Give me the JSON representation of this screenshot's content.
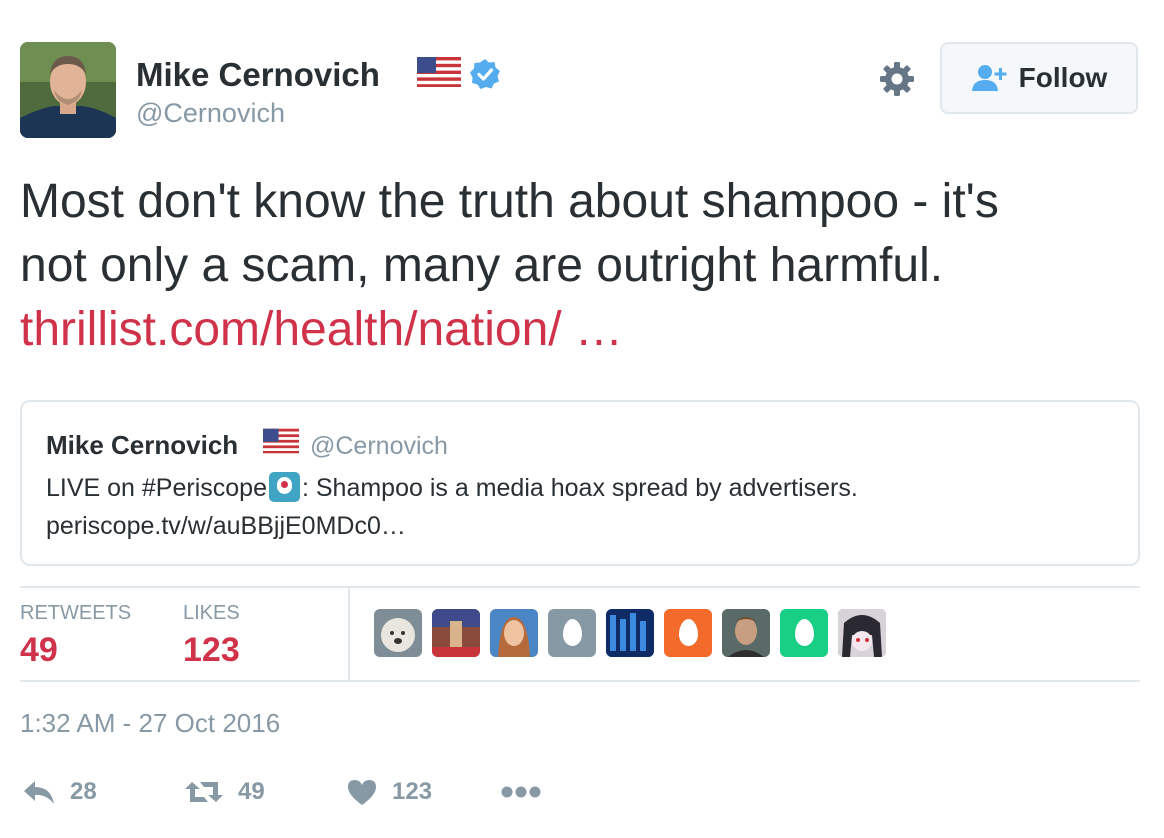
{
  "user": {
    "display_name": "Mike Cernovich",
    "handle": "@Cernovich",
    "flag_icon": "us-flag-icon",
    "verified_icon": "verified-badge-icon"
  },
  "header": {
    "follow_label": "Follow",
    "settings_icon": "gear-icon"
  },
  "tweet": {
    "line1": "Most don't know the truth about shampoo - it's",
    "line2": "not only a scam, many are outright harmful.",
    "link": "thrillist.com/health/nation/ …"
  },
  "quote": {
    "name": "Mike Cernovich",
    "handle": "@Cernovich",
    "text_prefix": "LIVE on #Periscope",
    "text_suffix": ": Shampoo is a media hoax spread by advertisers.",
    "link": "periscope.tv/w/auBBjjE0MDc0…"
  },
  "stats": {
    "retweets_label": "RETWEETS",
    "retweets_value": "49",
    "likes_label": "LIKES",
    "likes_value": "123"
  },
  "likers": [
    {
      "kind": "photo",
      "color": "#7f8d96"
    },
    {
      "kind": "photo",
      "color": "#8a4a3c"
    },
    {
      "kind": "photo",
      "color": "#b98467"
    },
    {
      "kind": "egg",
      "color": "#8899a6"
    },
    {
      "kind": "photo",
      "color": "#1f4f9e"
    },
    {
      "kind": "egg",
      "color": "#f26b2a"
    },
    {
      "kind": "photo",
      "color": "#6e7a7a"
    },
    {
      "kind": "egg",
      "color": "#19cf86"
    },
    {
      "kind": "photo",
      "color": "#3c3a40"
    }
  ],
  "timestamp": "1:32 AM - 27 Oct 2016",
  "actions": {
    "reply_count": "28",
    "retweet_count": "49",
    "like_count": "123"
  },
  "colors": {
    "accent": "#d0324a",
    "muted": "#8899a6",
    "text": "#292f33",
    "border": "#e1e8ed",
    "verified": "#55acee"
  }
}
